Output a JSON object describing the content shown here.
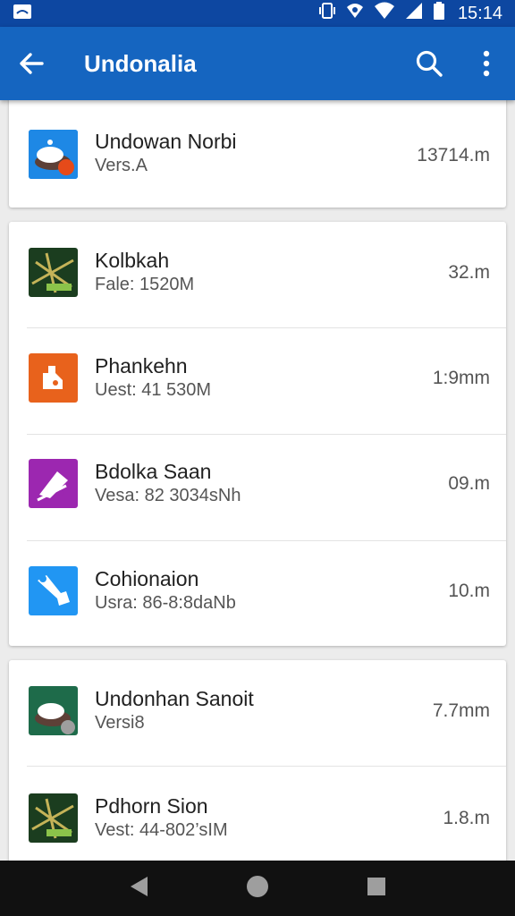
{
  "status_bar": {
    "time": "15:14"
  },
  "app_bar": {
    "title": "Undonalia",
    "color": "#1565c0"
  },
  "top_partial_item": {
    "name": "Undowan Norbi",
    "subtitle": "Vers.A",
    "size": "13714.m"
  },
  "group_2": [
    {
      "name": "Kolbkah",
      "subtitle": "Fale: 1520M",
      "size": "32.m",
      "icon": "game-icon-green"
    },
    {
      "name": "Phankehn",
      "subtitle": "Uest: 41 530M",
      "size": "1:9mm",
      "icon": "orange-tag-icon"
    },
    {
      "name": "Bdolka Saan",
      "subtitle": "Vesa: 82 3034sNh",
      "size": "09.m",
      "icon": "purple-pen-icon"
    },
    {
      "name": "Cohionaion",
      "subtitle": "Usra: 86-8:8daNb",
      "size": "10.m",
      "icon": "blue-tool-icon"
    }
  ],
  "group_3": [
    {
      "name": "Undonhan Sanoit",
      "subtitle": "Versi8",
      "size": "7.7mm",
      "icon": "food-icon"
    },
    {
      "name": "Pdhorn Sion",
      "subtitle": "Vest: 44-802’sIM",
      "size": "1.8.m",
      "icon": "game-icon-green"
    }
  ]
}
